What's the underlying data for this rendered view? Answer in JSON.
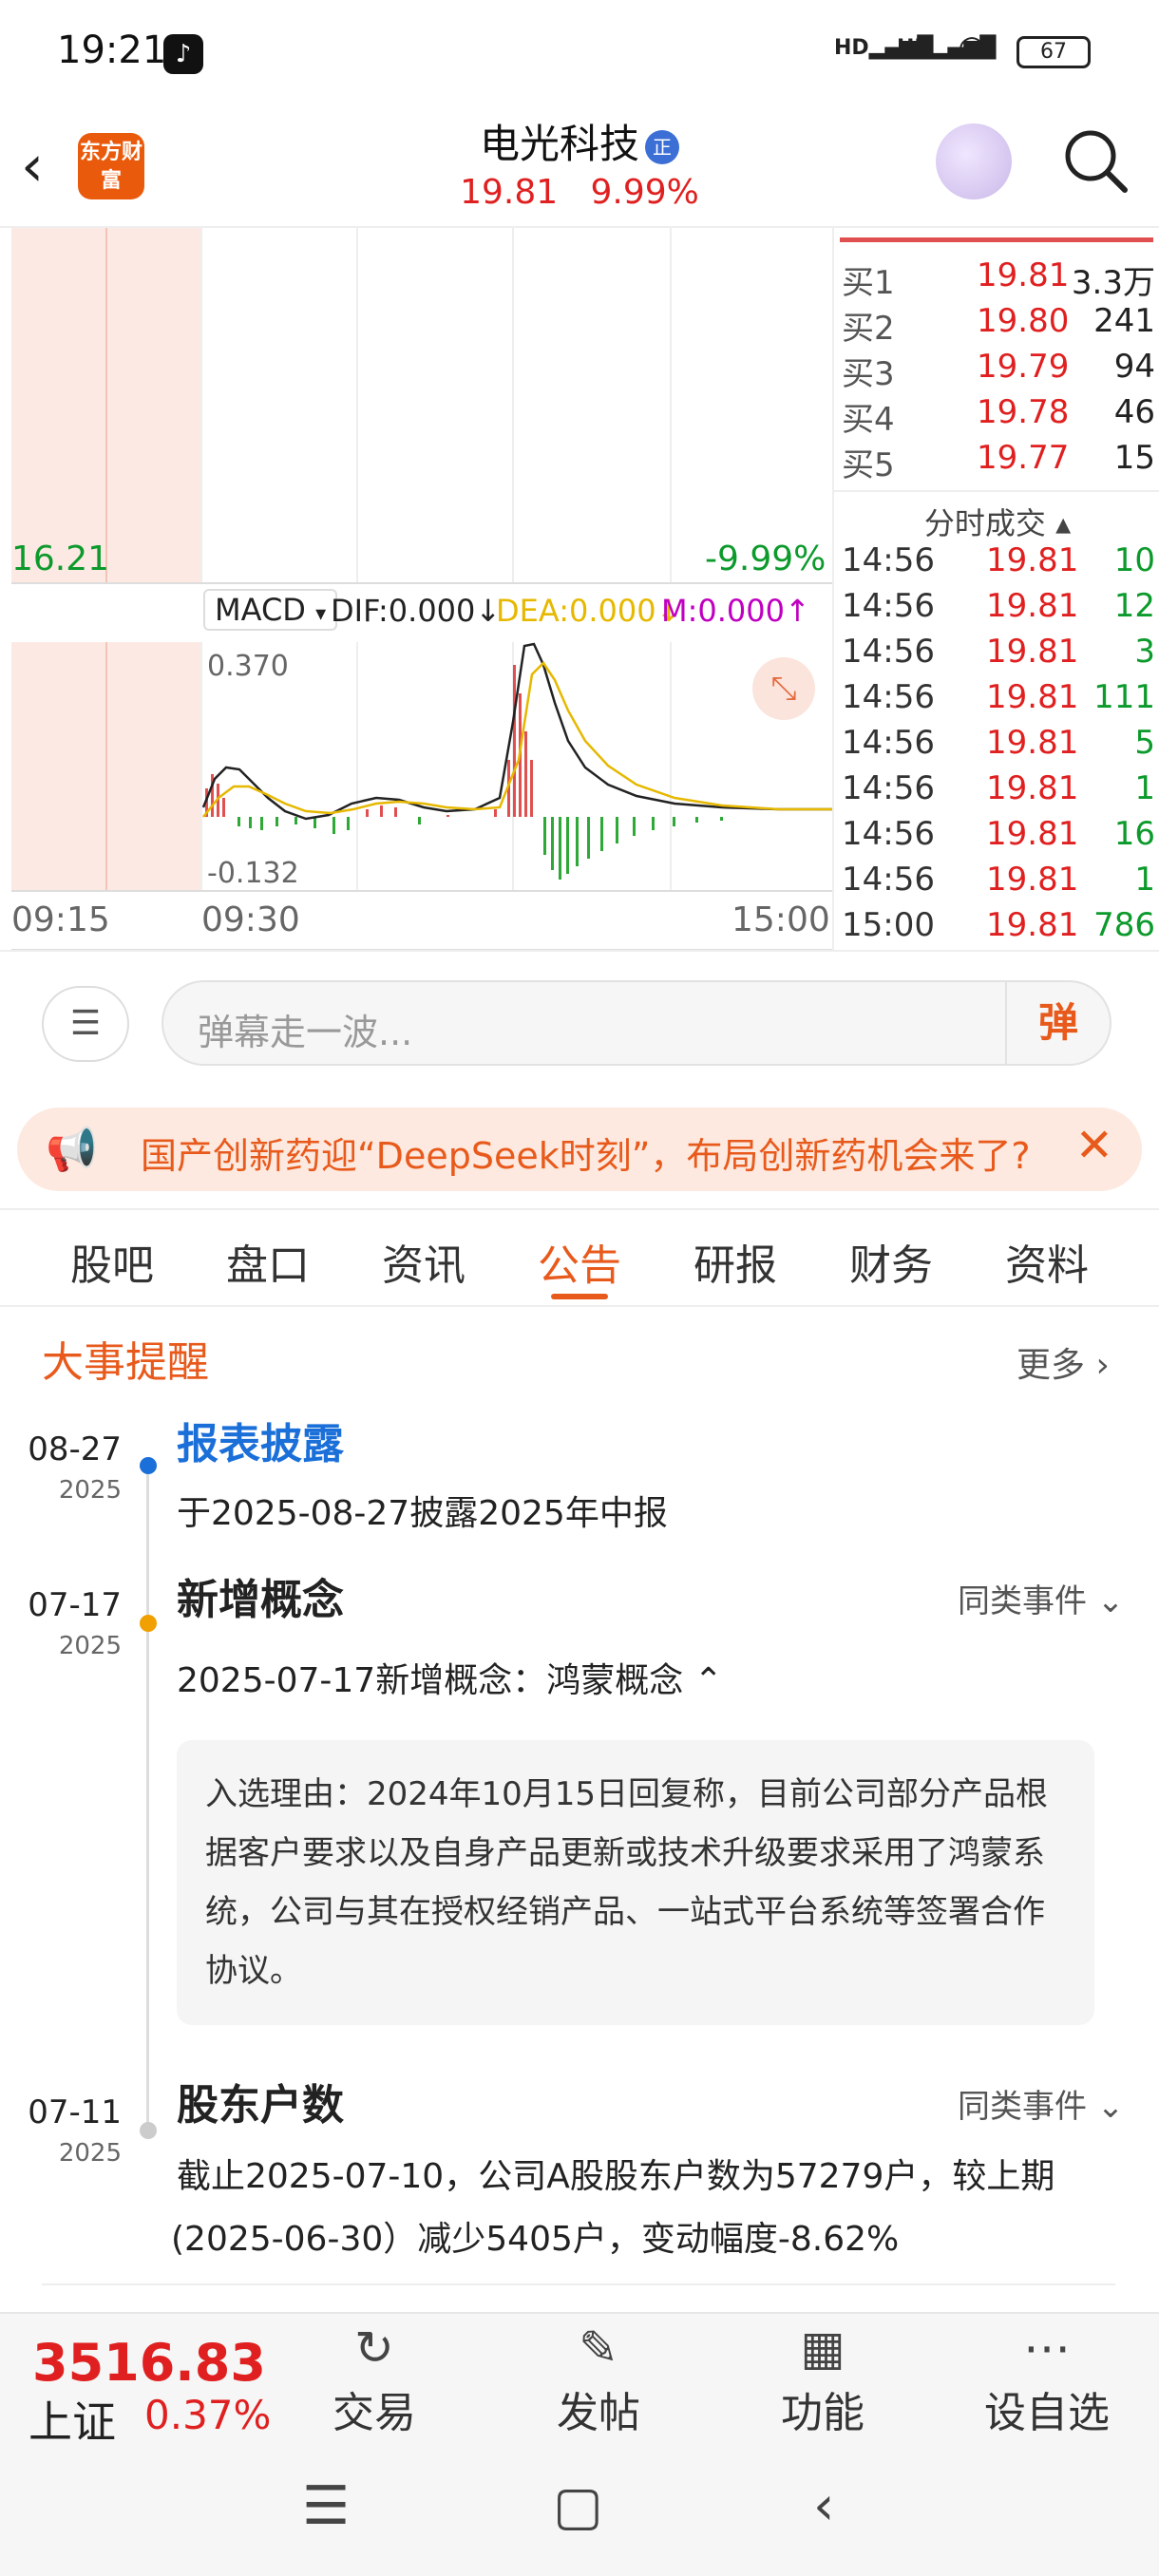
{
  "status": {
    "time": "19:21",
    "net1": "HD",
    "net2": "HD",
    "battery": "67"
  },
  "header": {
    "logo": "东方财富",
    "stock_name": "电光科技",
    "badge": "正",
    "price": "19.81",
    "change_pct": "9.99%"
  },
  "chart": {
    "price_low": "16.21",
    "pct_low": "-9.99%",
    "indicator": "MACD",
    "dif": "DIF:0.000",
    "dea": "DEA:0.000",
    "m": "M:0.000",
    "macd_max": "0.370",
    "macd_min": "-0.132",
    "time_start": "09:15",
    "time_open": "09:30",
    "time_end": "15:00",
    "colors": {
      "up": "#e02020",
      "down": "#0c9a2c",
      "dif": "#222222",
      "dea": "#e6b800",
      "m": "#c000c0"
    }
  },
  "orderbook": {
    "bids": [
      {
        "label": "买1",
        "price": "19.81",
        "vol": "3.3万"
      },
      {
        "label": "买2",
        "price": "19.80",
        "vol": "241"
      },
      {
        "label": "买3",
        "price": "19.79",
        "vol": "94"
      },
      {
        "label": "买4",
        "price": "19.78",
        "vol": "46"
      },
      {
        "label": "买5",
        "price": "19.77",
        "vol": "15"
      }
    ],
    "ticks_title": "分时成交",
    "ticks": [
      {
        "time": "14:56",
        "price": "19.81",
        "vol": "10"
      },
      {
        "time": "14:56",
        "price": "19.81",
        "vol": "12"
      },
      {
        "time": "14:56",
        "price": "19.81",
        "vol": "3"
      },
      {
        "time": "14:56",
        "price": "19.81",
        "vol": "111"
      },
      {
        "time": "14:56",
        "price": "19.81",
        "vol": "5"
      },
      {
        "time": "14:56",
        "price": "19.81",
        "vol": "1"
      },
      {
        "time": "14:56",
        "price": "19.81",
        "vol": "16"
      },
      {
        "time": "14:56",
        "price": "19.81",
        "vol": "1"
      },
      {
        "time": "15:00",
        "price": "19.81",
        "vol": "786"
      }
    ]
  },
  "comment": {
    "placeholder": "弹幕走一波...",
    "dan_label": "弹"
  },
  "banner": {
    "text": "国产创新药迎“DeepSeek时刻”，布局创新药机会来了?"
  },
  "tabs": [
    {
      "label": "股吧"
    },
    {
      "label": "盘口"
    },
    {
      "label": "资讯"
    },
    {
      "label": "公告"
    },
    {
      "label": "研报"
    },
    {
      "label": "财务"
    },
    {
      "label": "资料"
    }
  ],
  "events": {
    "section_title": "大事提醒",
    "more": "更多",
    "items": [
      {
        "date": "08-27",
        "year": "2025",
        "title": "报表披露",
        "desc": "于2025-08-27披露2025年中报"
      },
      {
        "date": "07-17",
        "year": "2025",
        "title": "新增概念",
        "same": "同类事件",
        "desc": "2025-07-17新增概念：鸿蒙概念",
        "reason": "入选理由：2024年10月15日回复称，目前公司部分产品根据客户要求以及自身产品更新或技术升级要求采用了鸿蒙系统，公司与其在授权经销产品、一站式平台系统等签署合作协议。"
      },
      {
        "date": "07-11",
        "year": "2025",
        "title": "股东户数",
        "same": "同类事件",
        "desc1": "截止2025-07-10，公司A股股东户数为57279户，较上期",
        "desc2": "(2025-06-30）减少5405户，变动幅度-8.62%"
      }
    ]
  },
  "bottom": {
    "index_value": "3516.83",
    "index_name": "上证",
    "index_pct": "0.37%",
    "nav": [
      {
        "label": "交易"
      },
      {
        "label": "发帖"
      },
      {
        "label": "功能"
      },
      {
        "label": "设自选"
      }
    ]
  }
}
